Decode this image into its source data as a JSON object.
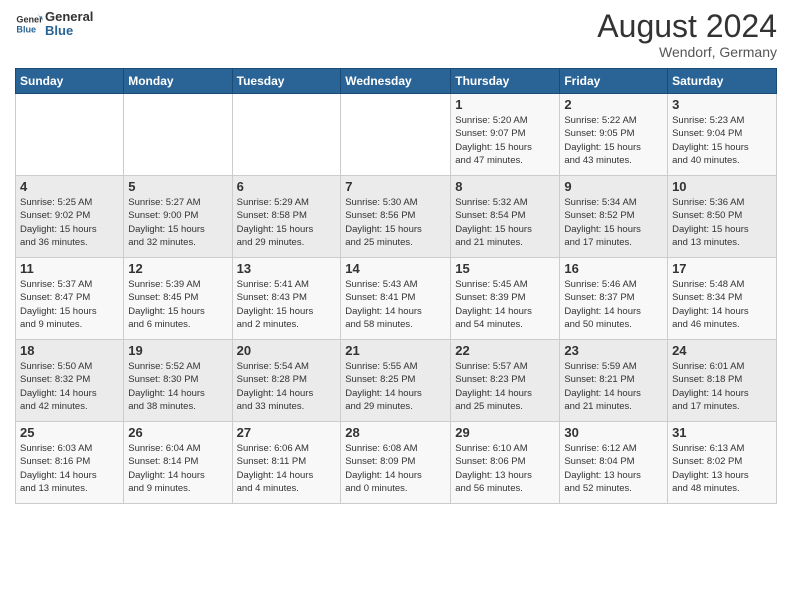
{
  "header": {
    "logo_general": "General",
    "logo_blue": "Blue",
    "month_title": "August 2024",
    "location": "Wendorf, Germany"
  },
  "weekdays": [
    "Sunday",
    "Monday",
    "Tuesday",
    "Wednesday",
    "Thursday",
    "Friday",
    "Saturday"
  ],
  "weeks": [
    [
      {
        "day": "",
        "info": ""
      },
      {
        "day": "",
        "info": ""
      },
      {
        "day": "",
        "info": ""
      },
      {
        "day": "",
        "info": ""
      },
      {
        "day": "1",
        "info": "Sunrise: 5:20 AM\nSunset: 9:07 PM\nDaylight: 15 hours\nand 47 minutes."
      },
      {
        "day": "2",
        "info": "Sunrise: 5:22 AM\nSunset: 9:05 PM\nDaylight: 15 hours\nand 43 minutes."
      },
      {
        "day": "3",
        "info": "Sunrise: 5:23 AM\nSunset: 9:04 PM\nDaylight: 15 hours\nand 40 minutes."
      }
    ],
    [
      {
        "day": "4",
        "info": "Sunrise: 5:25 AM\nSunset: 9:02 PM\nDaylight: 15 hours\nand 36 minutes."
      },
      {
        "day": "5",
        "info": "Sunrise: 5:27 AM\nSunset: 9:00 PM\nDaylight: 15 hours\nand 32 minutes."
      },
      {
        "day": "6",
        "info": "Sunrise: 5:29 AM\nSunset: 8:58 PM\nDaylight: 15 hours\nand 29 minutes."
      },
      {
        "day": "7",
        "info": "Sunrise: 5:30 AM\nSunset: 8:56 PM\nDaylight: 15 hours\nand 25 minutes."
      },
      {
        "day": "8",
        "info": "Sunrise: 5:32 AM\nSunset: 8:54 PM\nDaylight: 15 hours\nand 21 minutes."
      },
      {
        "day": "9",
        "info": "Sunrise: 5:34 AM\nSunset: 8:52 PM\nDaylight: 15 hours\nand 17 minutes."
      },
      {
        "day": "10",
        "info": "Sunrise: 5:36 AM\nSunset: 8:50 PM\nDaylight: 15 hours\nand 13 minutes."
      }
    ],
    [
      {
        "day": "11",
        "info": "Sunrise: 5:37 AM\nSunset: 8:47 PM\nDaylight: 15 hours\nand 9 minutes."
      },
      {
        "day": "12",
        "info": "Sunrise: 5:39 AM\nSunset: 8:45 PM\nDaylight: 15 hours\nand 6 minutes."
      },
      {
        "day": "13",
        "info": "Sunrise: 5:41 AM\nSunset: 8:43 PM\nDaylight: 15 hours\nand 2 minutes."
      },
      {
        "day": "14",
        "info": "Sunrise: 5:43 AM\nSunset: 8:41 PM\nDaylight: 14 hours\nand 58 minutes."
      },
      {
        "day": "15",
        "info": "Sunrise: 5:45 AM\nSunset: 8:39 PM\nDaylight: 14 hours\nand 54 minutes."
      },
      {
        "day": "16",
        "info": "Sunrise: 5:46 AM\nSunset: 8:37 PM\nDaylight: 14 hours\nand 50 minutes."
      },
      {
        "day": "17",
        "info": "Sunrise: 5:48 AM\nSunset: 8:34 PM\nDaylight: 14 hours\nand 46 minutes."
      }
    ],
    [
      {
        "day": "18",
        "info": "Sunrise: 5:50 AM\nSunset: 8:32 PM\nDaylight: 14 hours\nand 42 minutes."
      },
      {
        "day": "19",
        "info": "Sunrise: 5:52 AM\nSunset: 8:30 PM\nDaylight: 14 hours\nand 38 minutes."
      },
      {
        "day": "20",
        "info": "Sunrise: 5:54 AM\nSunset: 8:28 PM\nDaylight: 14 hours\nand 33 minutes."
      },
      {
        "day": "21",
        "info": "Sunrise: 5:55 AM\nSunset: 8:25 PM\nDaylight: 14 hours\nand 29 minutes."
      },
      {
        "day": "22",
        "info": "Sunrise: 5:57 AM\nSunset: 8:23 PM\nDaylight: 14 hours\nand 25 minutes."
      },
      {
        "day": "23",
        "info": "Sunrise: 5:59 AM\nSunset: 8:21 PM\nDaylight: 14 hours\nand 21 minutes."
      },
      {
        "day": "24",
        "info": "Sunrise: 6:01 AM\nSunset: 8:18 PM\nDaylight: 14 hours\nand 17 minutes."
      }
    ],
    [
      {
        "day": "25",
        "info": "Sunrise: 6:03 AM\nSunset: 8:16 PM\nDaylight: 14 hours\nand 13 minutes."
      },
      {
        "day": "26",
        "info": "Sunrise: 6:04 AM\nSunset: 8:14 PM\nDaylight: 14 hours\nand 9 minutes."
      },
      {
        "day": "27",
        "info": "Sunrise: 6:06 AM\nSunset: 8:11 PM\nDaylight: 14 hours\nand 4 minutes."
      },
      {
        "day": "28",
        "info": "Sunrise: 6:08 AM\nSunset: 8:09 PM\nDaylight: 14 hours\nand 0 minutes."
      },
      {
        "day": "29",
        "info": "Sunrise: 6:10 AM\nSunset: 8:06 PM\nDaylight: 13 hours\nand 56 minutes."
      },
      {
        "day": "30",
        "info": "Sunrise: 6:12 AM\nSunset: 8:04 PM\nDaylight: 13 hours\nand 52 minutes."
      },
      {
        "day": "31",
        "info": "Sunrise: 6:13 AM\nSunset: 8:02 PM\nDaylight: 13 hours\nand 48 minutes."
      }
    ]
  ]
}
